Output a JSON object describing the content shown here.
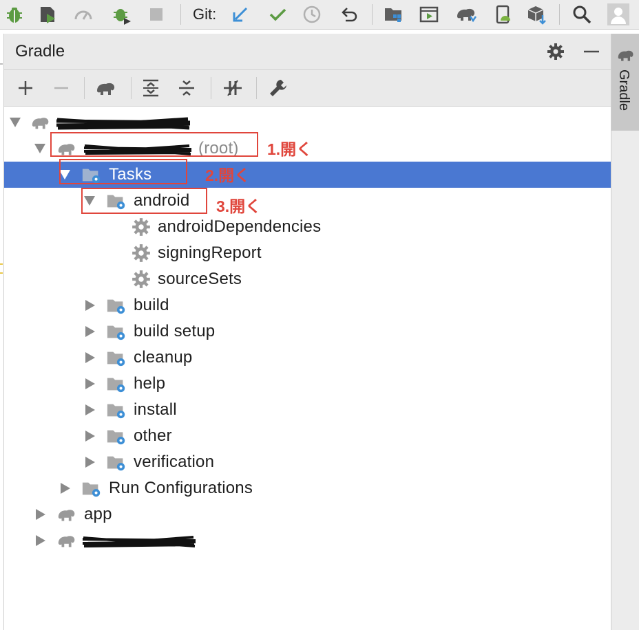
{
  "toolbar": {
    "git_label": "Git:",
    "icons": [
      "debug-icon",
      "attach-debugger-icon",
      "profile-icon",
      "apply-changes-icon",
      "stop-icon",
      "git-update-icon",
      "git-commit-icon",
      "git-history-icon",
      "git-revert-icon",
      "project-structure-icon",
      "run-config-icon",
      "sync-gradle-icon",
      "avd-manager-icon",
      "sdk-manager-icon",
      "search-icon",
      "account-icon"
    ]
  },
  "panel": {
    "title": "Gradle",
    "header_icons": [
      "gear-icon",
      "minimize-icon"
    ],
    "toolbar_icons": [
      "add-icon",
      "remove-icon",
      "refresh-gradle-icon",
      "expand-all-icon",
      "collapse-all-icon",
      "toggle-offline-icon",
      "build-settings-icon"
    ]
  },
  "tree": {
    "root_suffix": "(root)",
    "tasks": "Tasks",
    "android": "android",
    "android_tasks": [
      "androidDependencies",
      "signingReport",
      "sourceSets"
    ],
    "task_groups": [
      "build",
      "build setup",
      "cleanup",
      "help",
      "install",
      "other",
      "verification"
    ],
    "run_configurations": "Run Configurations",
    "app": "app"
  },
  "annotations": [
    "1.開く",
    "2.開く",
    "3.開く"
  ],
  "right_stripe": {
    "label": "Gradle"
  },
  "colors": {
    "selection": "#4a78d2",
    "annotation": "#e0463c",
    "icon_gray": "#9a9a9a",
    "gear_blue": "#3d8fd6"
  }
}
